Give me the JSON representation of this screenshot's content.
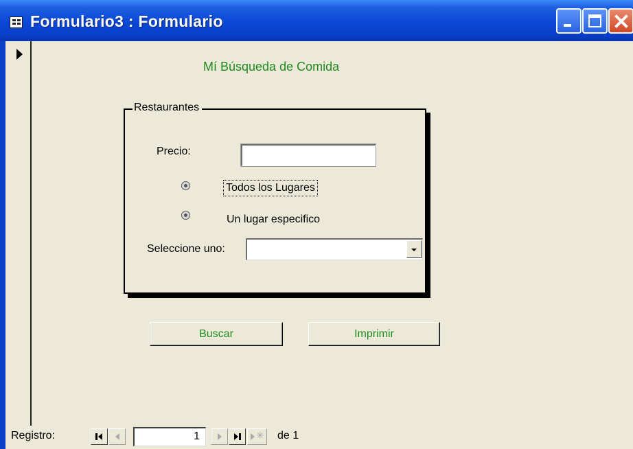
{
  "window": {
    "title": "Formulario3 : Formulario"
  },
  "form": {
    "title": "Mí Búsqueda de Comida",
    "group_label": "Restaurantes",
    "price_label": "Precio:",
    "price_value": "",
    "option_all": "Todos los Lugares",
    "option_specific": "Un lugar especifico",
    "select_label": "Seleccione uno:",
    "select_value": "",
    "search_button": "Buscar",
    "print_button": "Imprimir"
  },
  "navigation": {
    "label": "Registro:",
    "current_record": "1",
    "of_text": "de 1"
  },
  "colors": {
    "title_bar": "#0A47D6",
    "form_text_green": "#1E8A1E",
    "background": "#ECE9D8"
  }
}
